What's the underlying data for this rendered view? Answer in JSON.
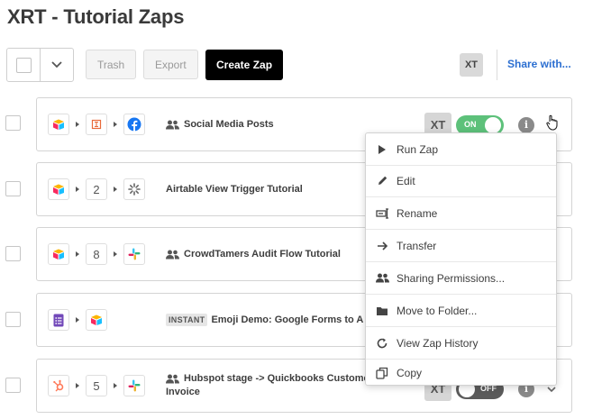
{
  "page": {
    "title": "XRT - Tutorial Zaps"
  },
  "toolbar": {
    "trash_label": "Trash",
    "export_label": "Export",
    "create_label": "Create Zap",
    "owner_initials": "XT",
    "share_label": "Share with..."
  },
  "zaps": [
    {
      "name": "Social Media Posts",
      "step_count": "",
      "shared": true,
      "instant": false,
      "owner": "XT",
      "status_label": "ON",
      "status": "on",
      "apps": [
        "airtable-icon",
        "formatter-icon",
        "facebook-icon"
      ]
    },
    {
      "name": "Airtable View Trigger Tutorial",
      "step_count": "2",
      "shared": false,
      "instant": false,
      "apps": [
        "airtable-icon",
        "step-count",
        "settings-icon"
      ]
    },
    {
      "name": "CrowdTamers Audit Flow Tutorial",
      "step_count": "8",
      "shared": true,
      "instant": false,
      "apps": [
        "airtable-icon",
        "step-count",
        "slack-icon"
      ]
    },
    {
      "name": "Emoji Demo: Google Forms to A",
      "step_count": "",
      "shared": false,
      "instant": true,
      "instant_label": "INSTANT",
      "apps": [
        "google-forms-icon",
        "airtable-icon"
      ]
    },
    {
      "name_line1": "Hubspot stage -> Quickbooks Custome",
      "name_line2": "Invoice",
      "step_count": "5",
      "shared": true,
      "instant": false,
      "owner": "XT",
      "status_label": "OFF",
      "status": "off",
      "apps": [
        "hubspot-icon",
        "step-count",
        "slack-icon"
      ]
    }
  ],
  "menu": {
    "items": [
      {
        "label": "Run Zap",
        "icon": "play-icon"
      },
      {
        "label": "Edit",
        "icon": "pencil-icon"
      },
      {
        "label": "Rename",
        "icon": "rename-icon"
      },
      {
        "label": "Transfer",
        "icon": "arrow-right-icon"
      },
      {
        "label": "Sharing Permissions...",
        "icon": "people-icon"
      },
      {
        "label": "Move to Folder...",
        "icon": "folder-icon"
      },
      {
        "label": "View Zap History",
        "icon": "history-icon"
      },
      {
        "label": "Copy",
        "icon": "copy-icon"
      }
    ]
  },
  "colors": {
    "accent_link": "#2c6fd1",
    "toggle_on": "#5dc17a",
    "toggle_off": "#5b5b5b",
    "primary_button": "#000000"
  }
}
